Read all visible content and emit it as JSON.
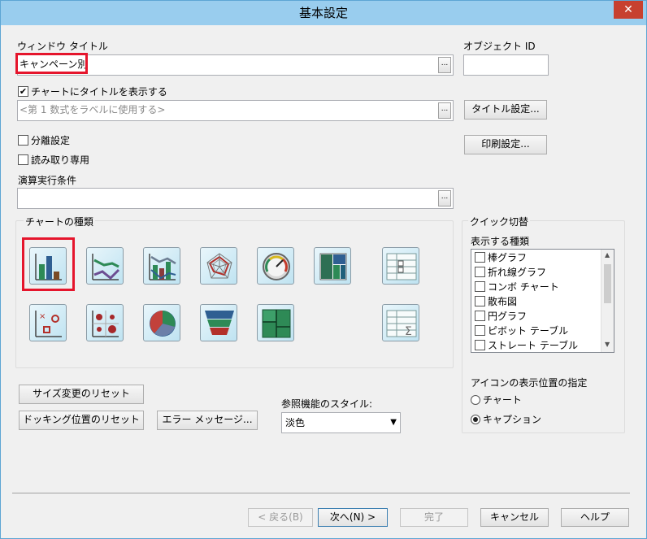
{
  "window": {
    "title": "基本設定",
    "close_glyph": "✕"
  },
  "window_title_field": {
    "label": "ウィンドウ タイトル",
    "value": "キャンペーン別"
  },
  "object_id": {
    "label": "オブジェクト ID",
    "value": ""
  },
  "show_title_checkbox": {
    "label": "チャートにタイトルを表示する",
    "checked": true
  },
  "title_expression": {
    "placeholder": "<第 1 数式をラベルに使用する>"
  },
  "title_settings_button": "タイトル設定...",
  "print_settings_button": "印刷設定...",
  "detached_checkbox": {
    "label": "分離設定",
    "checked": false
  },
  "readonly_checkbox": {
    "label": "読み取り専用",
    "checked": false
  },
  "calc_condition": {
    "label": "演算実行条件",
    "value": ""
  },
  "ellipsis_label": "...",
  "chart_types": {
    "group_label": "チャートの種類",
    "selected": "bar-chart",
    "icons": [
      "bar-chart",
      "line-chart",
      "combo-chart",
      "radar-chart",
      "gauge-chart",
      "block-chart",
      "pivot-table",
      "scatter-chart",
      "grid-chart",
      "pie-chart",
      "funnel-chart",
      "mekko-chart",
      "straight-table"
    ]
  },
  "quick_change": {
    "group_label": "クイック切替",
    "list_label": "表示する種類",
    "items": [
      "棒グラフ",
      "折れ線グラフ",
      "コンボ チャート",
      "散布図",
      "円グラフ",
      "ピボット テーブル",
      "ストレート テーブル"
    ],
    "icon_position_label": "アイコンの表示位置の指定",
    "radio_chart": "チャート",
    "radio_caption": "キャプション",
    "selected_radio": "キャプション"
  },
  "reset_size_button": "サイズ変更のリセット",
  "reset_docking_button": "ドッキング位置のリセット",
  "error_message_button": "エラー メッセージ...",
  "reference_style": {
    "label": "参照機能のスタイル:",
    "value": "淡色"
  },
  "footer": {
    "back": "< 戻る(B)",
    "next": "次へ(N) >",
    "finish": "完了",
    "cancel": "キャンセル",
    "help": "ヘルプ"
  }
}
